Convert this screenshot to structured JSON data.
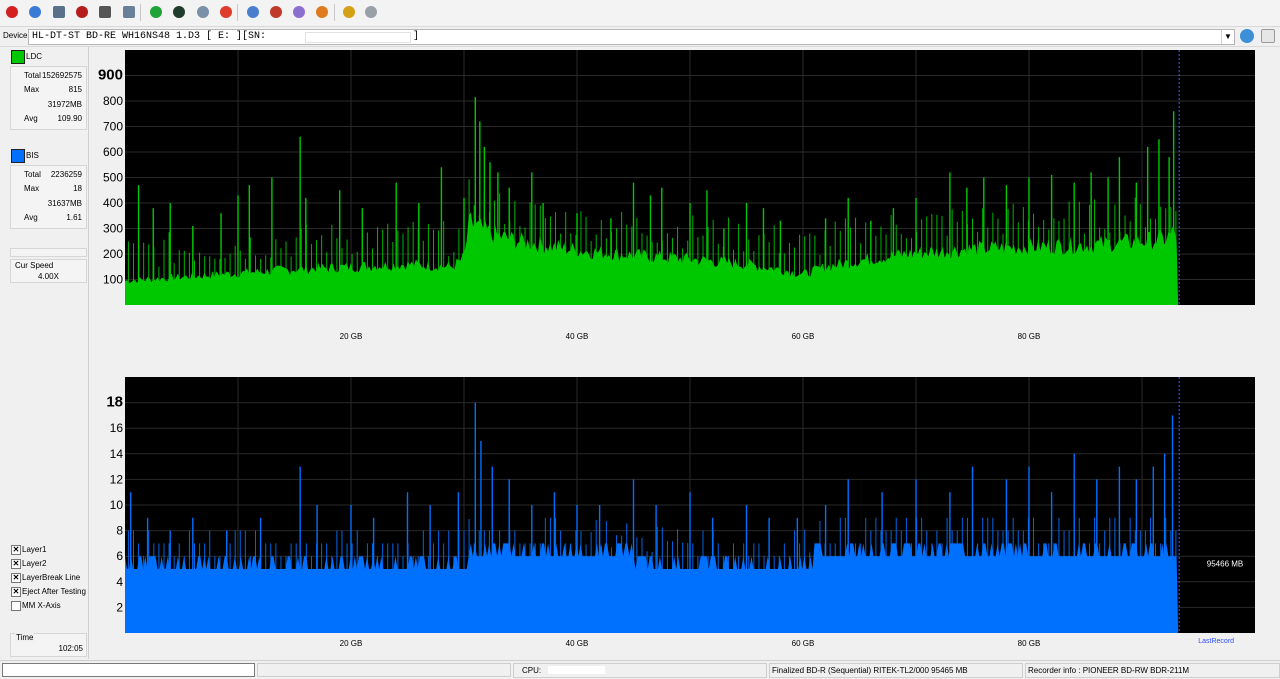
{
  "device": {
    "label": "Device:",
    "value": "HL-DT-ST BD-RE  WH16NS48  1.D3 [ E: ][SN:",
    "suffix": "]"
  },
  "toolbar_icons": [
    "power-icon",
    "config-icon",
    "drive-icon",
    "disc-erase-icon",
    "disc-icon",
    "eject-icon",
    "refresh-icon",
    "globe-icon",
    "test-icon",
    "stop-icon",
    "burn-icon",
    "save-icon",
    "screenshot-icon",
    "record-icon",
    "chart-icon",
    "pin-icon"
  ],
  "colors": {
    "ldc": "#00c800",
    "bis": "#0070ff",
    "plot_bg": "#000000",
    "grid": "#2a2a2a",
    "marker": "#4060ff"
  },
  "ldc": {
    "name": "LDC",
    "rows": [
      {
        "k": "Total",
        "v": "152692575"
      },
      {
        "k": "Max",
        "v": "815"
      },
      {
        "k": "",
        "v": "31972MB"
      },
      {
        "k": "Avg",
        "v": "109.90"
      }
    ]
  },
  "bis": {
    "name": "BIS",
    "rows": [
      {
        "k": "Total",
        "v": "2236259"
      },
      {
        "k": "Max",
        "v": "18"
      },
      {
        "k": "",
        "v": "31637MB"
      },
      {
        "k": "Avg",
        "v": "1.61"
      }
    ]
  },
  "speed": {
    "label": "Cur Speed",
    "value": "4.00X"
  },
  "options": [
    {
      "label": "Layer1",
      "checked": true
    },
    {
      "label": "Layer2",
      "checked": true
    },
    {
      "label": "LayerBreak Line",
      "checked": true
    },
    {
      "label": "Eject After Testing",
      "checked": true
    },
    {
      "label": "MM X-Axis",
      "checked": false
    }
  ],
  "time": {
    "label": "Time",
    "value": "102:05"
  },
  "status": {
    "cpu": "CPU:",
    "disc": "Finalized  BD-R (Sequential)  RITEK-TL2/000  95465 MB",
    "recorder": "Recorder info : PIONEER     BD-RW  BDR-211M"
  },
  "chart_data": [
    {
      "type": "area",
      "series_name": "LDC",
      "x_unit": "GB",
      "x_ticks": [
        "20 GB",
        "40 GB",
        "60 GB",
        "80 GB"
      ],
      "x_tick_values": [
        20,
        40,
        60,
        80
      ],
      "xlim": [
        0,
        100
      ],
      "ylim": [
        0,
        1000
      ],
      "y_ticks": [
        100,
        200,
        300,
        400,
        500,
        600,
        700,
        800,
        900
      ],
      "y_max_label": "900",
      "data_end_gb": 93.2,
      "x": [
        0,
        5,
        10,
        15,
        20,
        25,
        29,
        30,
        30.5,
        31,
        32,
        33,
        34,
        35,
        38,
        40,
        45,
        50,
        55,
        58,
        60,
        62,
        65,
        70,
        75,
        80,
        85,
        90,
        92,
        93,
        93.2
      ],
      "baseline": [
        95,
        110,
        125,
        140,
        150,
        160,
        150,
        185,
        330,
        310,
        290,
        270,
        260,
        250,
        230,
        215,
        195,
        180,
        160,
        140,
        120,
        150,
        175,
        205,
        220,
        230,
        235,
        250,
        260,
        290,
        200
      ],
      "spikes": [
        {
          "x": 1.2,
          "y": 470
        },
        {
          "x": 2.5,
          "y": 380
        },
        {
          "x": 4,
          "y": 400
        },
        {
          "x": 6,
          "y": 310
        },
        {
          "x": 8.5,
          "y": 360
        },
        {
          "x": 10,
          "y": 430
        },
        {
          "x": 11,
          "y": 470
        },
        {
          "x": 13,
          "y": 500
        },
        {
          "x": 15.5,
          "y": 660
        },
        {
          "x": 16,
          "y": 420
        },
        {
          "x": 19,
          "y": 450
        },
        {
          "x": 21,
          "y": 380
        },
        {
          "x": 24,
          "y": 480
        },
        {
          "x": 26,
          "y": 400
        },
        {
          "x": 28,
          "y": 540
        },
        {
          "x": 30,
          "y": 420
        },
        {
          "x": 31,
          "y": 815
        },
        {
          "x": 31.4,
          "y": 720
        },
        {
          "x": 31.8,
          "y": 620
        },
        {
          "x": 32.3,
          "y": 560
        },
        {
          "x": 33,
          "y": 520
        },
        {
          "x": 34,
          "y": 460
        },
        {
          "x": 36,
          "y": 520
        },
        {
          "x": 37,
          "y": 400
        },
        {
          "x": 40,
          "y": 360
        },
        {
          "x": 43,
          "y": 340
        },
        {
          "x": 45,
          "y": 480
        },
        {
          "x": 46.5,
          "y": 430
        },
        {
          "x": 47.5,
          "y": 460
        },
        {
          "x": 50,
          "y": 400
        },
        {
          "x": 51.5,
          "y": 450
        },
        {
          "x": 53,
          "y": 300
        },
        {
          "x": 55,
          "y": 400
        },
        {
          "x": 56.5,
          "y": 380
        },
        {
          "x": 58,
          "y": 330
        },
        {
          "x": 62,
          "y": 340
        },
        {
          "x": 64,
          "y": 420
        },
        {
          "x": 66,
          "y": 330
        },
        {
          "x": 68,
          "y": 380
        },
        {
          "x": 70,
          "y": 420
        },
        {
          "x": 73,
          "y": 520
        },
        {
          "x": 74.5,
          "y": 460
        },
        {
          "x": 76,
          "y": 500
        },
        {
          "x": 78,
          "y": 470
        },
        {
          "x": 80,
          "y": 500
        },
        {
          "x": 82,
          "y": 510
        },
        {
          "x": 84,
          "y": 480
        },
        {
          "x": 85.5,
          "y": 520
        },
        {
          "x": 87,
          "y": 500
        },
        {
          "x": 88,
          "y": 580
        },
        {
          "x": 89.5,
          "y": 480
        },
        {
          "x": 90.5,
          "y": 620
        },
        {
          "x": 91.5,
          "y": 650
        },
        {
          "x": 92.4,
          "y": 580
        },
        {
          "x": 92.8,
          "y": 760
        }
      ]
    },
    {
      "type": "bar",
      "series_name": "BIS",
      "x_unit": "GB",
      "x_ticks": [
        "20 GB",
        "40 GB",
        "60 GB",
        "80 GB"
      ],
      "x_tick_values": [
        20,
        40,
        60,
        80
      ],
      "xlim": [
        0,
        100
      ],
      "ylim": [
        0,
        20
      ],
      "y_ticks": [
        2,
        4,
        6,
        8,
        10,
        12,
        14,
        16,
        18
      ],
      "y_max_label": "18",
      "data_end_gb": 93.2,
      "x": [
        0,
        5,
        10,
        15,
        20,
        25,
        30,
        30.5,
        31,
        35,
        40,
        45,
        50,
        55,
        60,
        62,
        65,
        70,
        75,
        80,
        85,
        90,
        93.2
      ],
      "baseline": [
        5,
        5,
        5,
        5,
        5,
        5,
        5,
        6,
        6,
        6,
        6,
        5.5,
        5,
        5,
        5,
        6,
        6,
        6,
        6,
        6,
        6,
        6,
        6
      ],
      "spikes": [
        {
          "x": 0.5,
          "y": 11
        },
        {
          "x": 2,
          "y": 9
        },
        {
          "x": 4,
          "y": 8
        },
        {
          "x": 6,
          "y": 9
        },
        {
          "x": 9,
          "y": 8
        },
        {
          "x": 12,
          "y": 9
        },
        {
          "x": 15.5,
          "y": 13
        },
        {
          "x": 17,
          "y": 10
        },
        {
          "x": 20,
          "y": 10
        },
        {
          "x": 22,
          "y": 9
        },
        {
          "x": 25,
          "y": 11
        },
        {
          "x": 27,
          "y": 10
        },
        {
          "x": 29.5,
          "y": 11
        },
        {
          "x": 31,
          "y": 18
        },
        {
          "x": 31.5,
          "y": 15
        },
        {
          "x": 32.5,
          "y": 13
        },
        {
          "x": 34,
          "y": 12
        },
        {
          "x": 36,
          "y": 10
        },
        {
          "x": 38,
          "y": 11
        },
        {
          "x": 40,
          "y": 10
        },
        {
          "x": 42,
          "y": 10
        },
        {
          "x": 45,
          "y": 12
        },
        {
          "x": 47,
          "y": 10
        },
        {
          "x": 50,
          "y": 11
        },
        {
          "x": 52,
          "y": 9
        },
        {
          "x": 55,
          "y": 10
        },
        {
          "x": 57,
          "y": 9
        },
        {
          "x": 59.5,
          "y": 9
        },
        {
          "x": 62,
          "y": 10
        },
        {
          "x": 64,
          "y": 12
        },
        {
          "x": 67,
          "y": 11
        },
        {
          "x": 70,
          "y": 12
        },
        {
          "x": 73,
          "y": 11
        },
        {
          "x": 75,
          "y": 13
        },
        {
          "x": 78,
          "y": 12
        },
        {
          "x": 80,
          "y": 13
        },
        {
          "x": 82,
          "y": 11
        },
        {
          "x": 84,
          "y": 14
        },
        {
          "x": 86,
          "y": 12
        },
        {
          "x": 88,
          "y": 13
        },
        {
          "x": 89.5,
          "y": 12
        },
        {
          "x": 91,
          "y": 13
        },
        {
          "x": 92,
          "y": 14
        },
        {
          "x": 92.7,
          "y": 17
        }
      ],
      "annotation": "95466 MB",
      "last_record_label": "LastRecord"
    }
  ]
}
